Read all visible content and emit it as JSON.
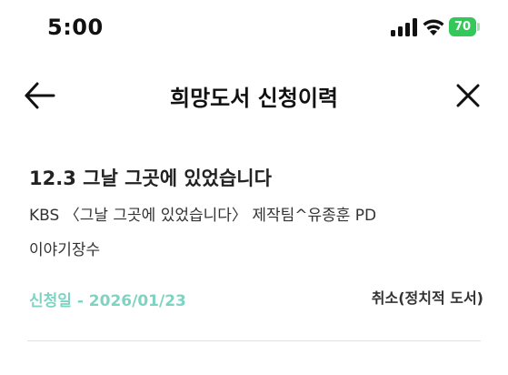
{
  "status_bar": {
    "time": "5:00",
    "battery": "70",
    "signal_icon": "cellular-signal-icon",
    "wifi_icon": "wifi-icon",
    "battery_color": "#34c759"
  },
  "header": {
    "title": "희망도서 신청이력",
    "back_icon": "arrow-left-icon",
    "close_icon": "close-icon"
  },
  "records": [
    {
      "title": "12.3 그날 그곳에 있었습니다",
      "author": "KBS 〈그날 그곳에 있었습니다〉 제작팀^유종훈 PD",
      "publisher": "이야기장수",
      "date": "신청일 - 2026/01/23",
      "status": "취소(정치적 도서)"
    }
  ],
  "colors": {
    "date_accent": "#7fd3c3",
    "divider": "#e2e2e2"
  }
}
